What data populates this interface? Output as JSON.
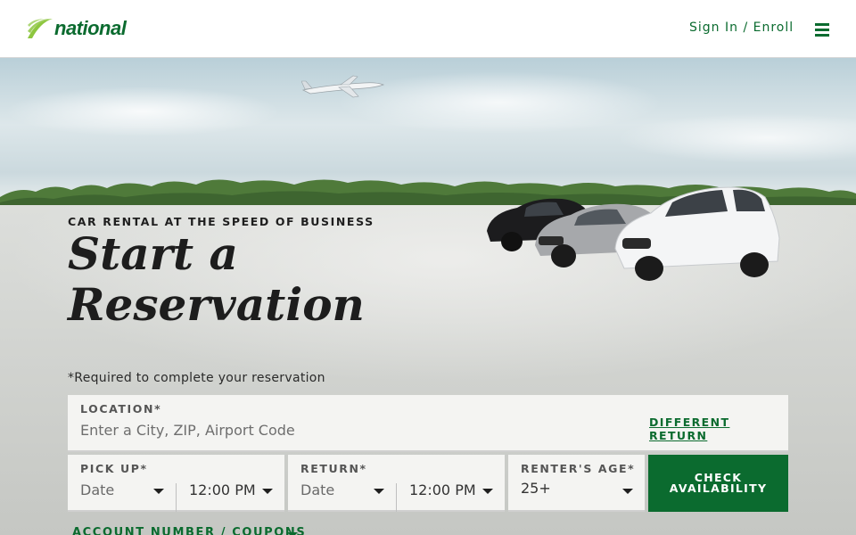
{
  "header": {
    "brand": "national",
    "signin_label": "Sign In / Enroll",
    "menu_icon": "hamburger-menu-icon"
  },
  "hero": {
    "tagline": "CAR RENTAL AT THE SPEED OF BUSINESS",
    "headline_line1": "Start a",
    "headline_line2": "Reservation"
  },
  "form": {
    "required_note": "*Required to complete your reservation",
    "location": {
      "label": "LOCATION*",
      "placeholder": "Enter a City, ZIP, Airport Code",
      "different_return": "DIFFERENT RETURN"
    },
    "pickup": {
      "label": "PICK UP*",
      "date": "Date",
      "time": "12:00 PM"
    },
    "return": {
      "label": "RETURN*",
      "date": "Date",
      "time": "12:00 PM"
    },
    "renter_age": {
      "label": "RENTER'S AGE*",
      "value": "25+"
    },
    "check_line1": "CHECK",
    "check_line2": "AVAILABILITY",
    "account_link": "ACCOUNT NUMBER / COUPONS"
  },
  "colors": {
    "brand_green": "#0b6b2f",
    "logo_lime": "#8dc63f"
  }
}
